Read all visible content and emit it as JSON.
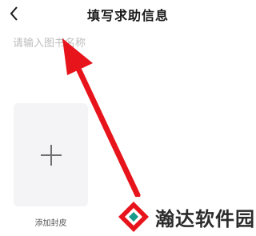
{
  "header": {
    "back_icon": "chevron-left-icon",
    "title": "填写求助信息"
  },
  "form": {
    "book_name_placeholder": "请输入图书名称",
    "book_name_value": ""
  },
  "cover": {
    "add_icon": "plus-icon",
    "label": "添加封皮"
  },
  "annotation": {
    "arrow_color": "#e8141b"
  },
  "watermark": {
    "text": "瀚达软件园",
    "logo_colors": [
      "#e8141b",
      "#1a9a8a"
    ]
  }
}
